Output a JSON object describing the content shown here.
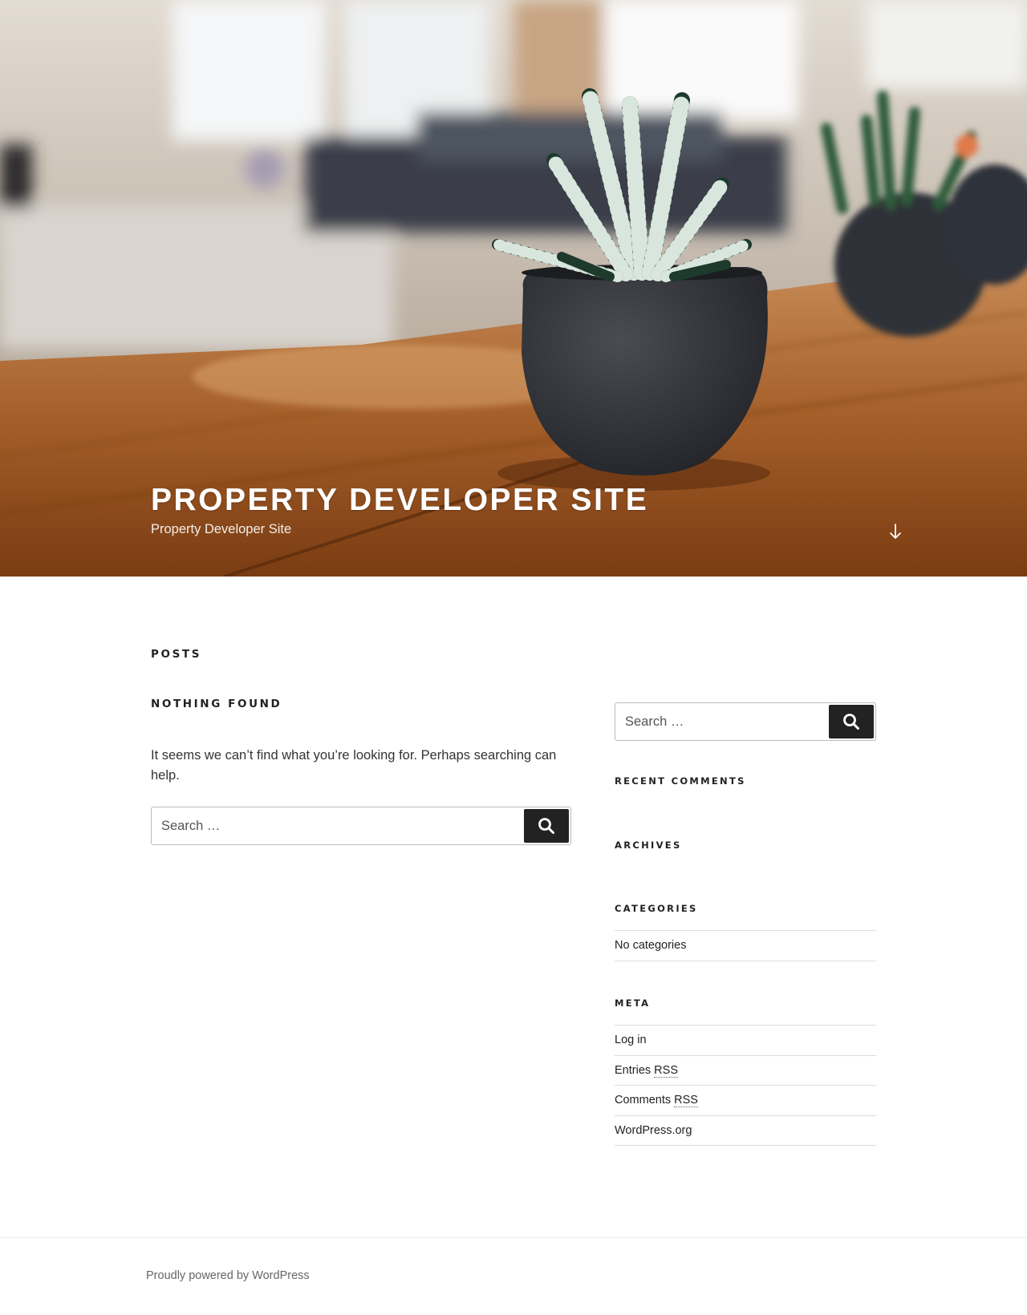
{
  "header": {
    "site_title": "PROPERTY DEVELOPER SITE",
    "site_description": "Property Developer Site",
    "hero_image": "succulent-plant-in-dark-pot-on-wooden-table",
    "scroll_icon": "arrow-down-icon"
  },
  "main": {
    "page_title": "POSTS",
    "entry_title": "NOTHING FOUND",
    "message": "It seems we can’t find what you’re looking for. Perhaps searching can help.",
    "search": {
      "placeholder": "Search …",
      "submit_icon": "search-icon"
    }
  },
  "sidebar": {
    "search": {
      "placeholder": "Search …",
      "submit_icon": "search-icon"
    },
    "recent_comments_title": "RECENT COMMENTS",
    "archives_title": "ARCHIVES",
    "categories_title": "CATEGORIES",
    "categories_items": [
      "No categories"
    ],
    "meta_title": "META",
    "meta_items": {
      "log_in": "Log in",
      "entries_prefix": "Entries ",
      "entries_rss": "RSS",
      "comments_prefix": "Comments ",
      "comments_rss": "RSS",
      "wordpress_org": "WordPress.org"
    }
  },
  "footer": {
    "site_info": "Proudly powered by WordPress"
  },
  "colors": {
    "button_bg": "#222222",
    "text": "#333333",
    "rule": "#dddddd"
  }
}
